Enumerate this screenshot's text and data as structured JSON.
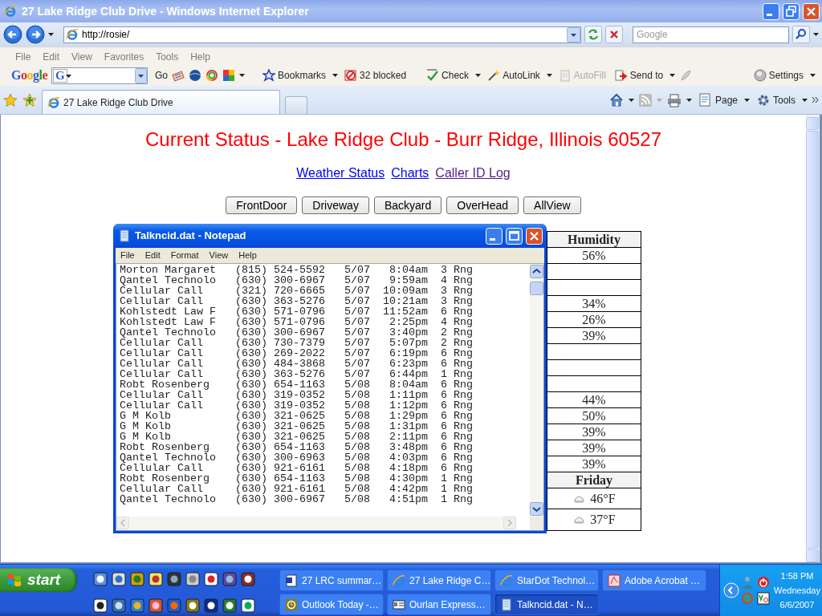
{
  "browser": {
    "title": "27 Lake Ridge Club Drive - Windows Internet Explorer",
    "address": "http://rosie/",
    "search": {
      "placeholder": "Google"
    },
    "menu": [
      "File",
      "Edit",
      "View",
      "Favorites",
      "Tools",
      "Help"
    ],
    "google_toolbar": {
      "logo": "Google",
      "engine": "G",
      "go": "Go",
      "items": [
        {
          "label": "Bookmarks",
          "dropdown": true,
          "disabled": false
        },
        {
          "label": "32 blocked",
          "dropdown": false,
          "disabled": false
        },
        {
          "label": "Check",
          "dropdown": true,
          "disabled": false
        },
        {
          "label": "AutoLink",
          "dropdown": true,
          "disabled": false
        },
        {
          "label": "AutoFill",
          "dropdown": false,
          "disabled": true
        },
        {
          "label": "Send to",
          "dropdown": true,
          "disabled": false
        }
      ],
      "settings": "Settings"
    },
    "tabs": [
      {
        "label": "27 Lake Ridge Club Drive",
        "selected": true
      },
      {
        "selected": false
      }
    ],
    "command_bar": [
      "Page",
      "Tools"
    ]
  },
  "page": {
    "title": "Current Status - Lake Ridge Club - Burr Ridge, Illinois 60527",
    "links": [
      {
        "label": "Weather Status",
        "visited": false
      },
      {
        "label": "Charts",
        "visited": false
      },
      {
        "label": "Caller ID Log",
        "visited": true
      }
    ],
    "buttons": [
      "FrontDoor",
      "Driveway",
      "Backyard",
      "OverHead",
      "AllView"
    ],
    "table_rows": [
      {
        "kind": "header",
        "text": "Humidity"
      },
      {
        "kind": "value",
        "text": "56%"
      },
      {
        "kind": "value"
      },
      {
        "kind": "value"
      },
      {
        "kind": "value",
        "text": "34%"
      },
      {
        "kind": "value",
        "text": "26%"
      },
      {
        "kind": "value",
        "text": "39%"
      },
      {
        "kind": "value"
      },
      {
        "kind": "value"
      },
      {
        "kind": "value"
      },
      {
        "kind": "value",
        "text": "44%"
      },
      {
        "kind": "value",
        "text": "50%"
      },
      {
        "kind": "value",
        "text": "39%"
      },
      {
        "kind": "value",
        "text": "39%"
      },
      {
        "kind": "value",
        "text": "39%"
      },
      {
        "kind": "header",
        "text": "Friday"
      },
      {
        "kind": "forecast",
        "text": "46°F"
      },
      {
        "kind": "forecast",
        "text": "37°F"
      }
    ]
  },
  "notepad": {
    "title": "Talkncid.dat - Notepad",
    "menu": [
      "File",
      "Edit",
      "Format",
      "View",
      "Help"
    ],
    "lines": [
      {
        "name": "Morton Margaret",
        "phone": "(815) 524-5592",
        "date": "5/07",
        "time": "8:04am",
        "rings": "3 Rng"
      },
      {
        "name": "Qantel Technolo",
        "phone": "(630) 300-6967",
        "date": "5/07",
        "time": "9:59am",
        "rings": "4 Rng"
      },
      {
        "name": "Cellular Call",
        "phone": "(321) 720-6665",
        "date": "5/07",
        "time": "10:09am",
        "rings": "3 Rng"
      },
      {
        "name": "Cellular Call",
        "phone": "(630) 363-5276",
        "date": "5/07",
        "time": "10:21am",
        "rings": "3 Rng"
      },
      {
        "name": "Kohlstedt Law F",
        "phone": "(630) 571-0796",
        "date": "5/07",
        "time": "11:52am",
        "rings": "6 Rng"
      },
      {
        "name": "Kohlstedt Law F",
        "phone": "(630) 571-0796",
        "date": "5/07",
        "time": "2:25pm",
        "rings": "4 Rng"
      },
      {
        "name": "Qantel Technolo",
        "phone": "(630) 300-6967",
        "date": "5/07",
        "time": "3:40pm",
        "rings": "2 Rng"
      },
      {
        "name": "Cellular Call",
        "phone": "(630) 730-7379",
        "date": "5/07",
        "time": "5:07pm",
        "rings": "2 Rng"
      },
      {
        "name": "Cellular Call",
        "phone": "(630) 269-2022",
        "date": "5/07",
        "time": "6:19pm",
        "rings": "6 Rng"
      },
      {
        "name": "Cellular Call",
        "phone": "(630) 484-3868",
        "date": "5/07",
        "time": "6:23pm",
        "rings": "6 Rng"
      },
      {
        "name": "Cellular Call",
        "phone": "(630) 363-5276",
        "date": "5/07",
        "time": "6:44pm",
        "rings": "1 Rng"
      },
      {
        "name": "Robt Rosenberg",
        "phone": "(630) 654-1163",
        "date": "5/08",
        "time": "8:04am",
        "rings": "6 Rng"
      },
      {
        "name": "Cellular Call",
        "phone": "(630) 319-0352",
        "date": "5/08",
        "time": "1:11pm",
        "rings": "6 Rng"
      },
      {
        "name": "Cellular Call",
        "phone": "(630) 319-0352",
        "date": "5/08",
        "time": "1:12pm",
        "rings": "6 Rng"
      },
      {
        "name": "G M Kolb",
        "phone": "(630) 321-0625",
        "date": "5/08",
        "time": "1:29pm",
        "rings": "6 Rng"
      },
      {
        "name": "G M Kolb",
        "phone": "(630) 321-0625",
        "date": "5/08",
        "time": "1:31pm",
        "rings": "6 Rng"
      },
      {
        "name": "G M Kolb",
        "phone": "(630) 321-0625",
        "date": "5/08",
        "time": "2:11pm",
        "rings": "6 Rng"
      },
      {
        "name": "Robt Rosenberg",
        "phone": "(630) 654-1163",
        "date": "5/08",
        "time": "3:48pm",
        "rings": "6 Rng"
      },
      {
        "name": "Qantel Technolo",
        "phone": "(630) 300-6963",
        "date": "5/08",
        "time": "4:03pm",
        "rings": "6 Rng"
      },
      {
        "name": "Cellular Call",
        "phone": "(630) 921-6161",
        "date": "5/08",
        "time": "4:18pm",
        "rings": "6 Rng"
      },
      {
        "name": "Robt Rosenberg",
        "phone": "(630) 654-1163",
        "date": "5/08",
        "time": "4:30pm",
        "rings": "1 Rng"
      },
      {
        "name": "Cellular Call",
        "phone": "(630) 921-6161",
        "date": "5/08",
        "time": "4:42pm",
        "rings": "1 Rng"
      },
      {
        "name": "Qantel Technolo",
        "phone": "(630) 300-6967",
        "date": "5/08",
        "time": "4:51pm",
        "rings": "1 Rng"
      }
    ]
  },
  "taskbar": {
    "start": "start",
    "tasks": [
      {
        "label": "27 LRC summar…",
        "kind": "document",
        "selected": false
      },
      {
        "label": "27 Lake Ridge C…",
        "kind": "browser",
        "selected": false
      },
      {
        "label": "StarDot Technol…",
        "kind": "browser",
        "selected": false
      },
      {
        "label": "Adobe Acrobat …",
        "kind": "pdf",
        "selected": false
      },
      {
        "label": "Outlook Today -…",
        "kind": "clock",
        "selected": false
      },
      {
        "label": "Ourlan Express…",
        "kind": "card",
        "selected": false
      },
      {
        "label": "Talkncid.dat - N…",
        "kind": "notepad",
        "selected": true
      }
    ],
    "clock": {
      "time": "1:58 PM",
      "day": "Wednesday",
      "date": "6/6/2007"
    }
  }
}
